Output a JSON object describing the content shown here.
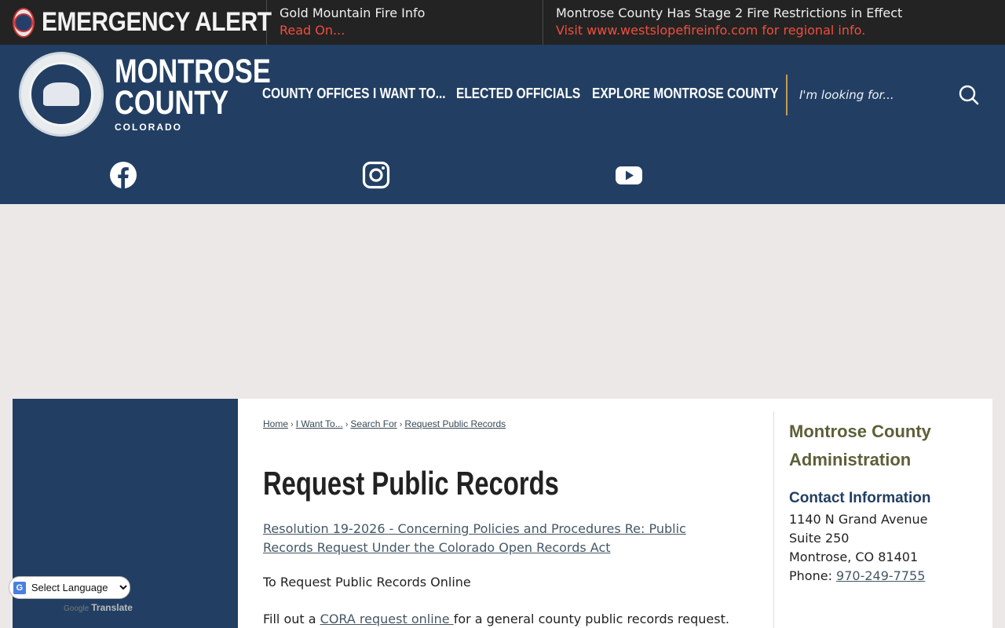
{
  "alert": {
    "label": "EMERGENCY ALERT",
    "items": [
      {
        "title": "Gold Mountain Fire Info",
        "link": "Read On..."
      },
      {
        "title": "Montrose County Has Stage 2 Fire Restrictions in Effect",
        "link": "Visit www.westslopefireinfo.com for regional info."
      }
    ]
  },
  "logo": {
    "line1": "MONTROSE",
    "line2": "COUNTY",
    "line3": "COLORADO"
  },
  "nav": [
    {
      "label": "COUNTY OFFICES"
    },
    {
      "label": "I WANT TO..."
    },
    {
      "label": "ELECTED OFFICIALS"
    },
    {
      "label": "EXPLORE MONTROSE COUNTY"
    }
  ],
  "search": {
    "placeholder": "I'm looking for..."
  },
  "social": [
    {
      "icon": "facebook-icon"
    },
    {
      "icon": "instagram-icon"
    },
    {
      "icon": "youtube-icon"
    }
  ],
  "breadcrumb": [
    "Home",
    "I Want To...",
    "Search For",
    "Request Public Records"
  ],
  "page": {
    "title": "Request Public Records",
    "resolution_link": "Resolution 19-2026 - Concerning Policies and Procedures Re: Public Records Request Under the Colorado Open Records Act",
    "online_text": "To Request Public Records Online",
    "fill_prefix": "Fill out a ",
    "fill_link": "CORA request online ",
    "fill_suffix": "for a general county public records request."
  },
  "aside": {
    "title": "Montrose County Administration",
    "subtitle": "Contact Information",
    "address1": "1140 N Grand Avenue",
    "address2": "Suite 250",
    "address3": "Montrose, CO 81401",
    "phone_label": "Phone: ",
    "phone": "970-249-7755"
  },
  "translate": {
    "select_label": "Select Language",
    "powered_brand": "Google",
    "powered_text": "Translate"
  },
  "colors": {
    "header": "#223f63",
    "alert_bg": "#232323",
    "alert_link": "#f04e3e",
    "aside_title": "#5c6038",
    "accent_divider": "#c79a54"
  }
}
